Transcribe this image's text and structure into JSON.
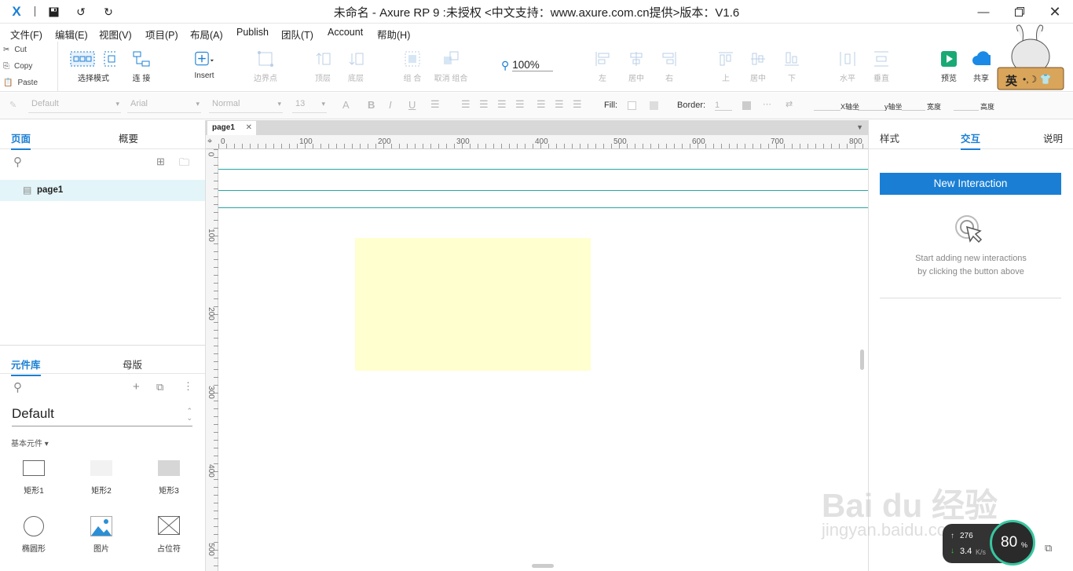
{
  "window": {
    "title": "未命名 - Axure RP 9  :未授权     <中文支持：www.axure.com.cn提供>版本：V1.6"
  },
  "menu": [
    "文件(F)",
    "编辑(E)",
    "视图(V)",
    "项目(P)",
    "布局(A)",
    "Publish",
    "团队(T)",
    "Account",
    "帮助(H)"
  ],
  "clipboard": {
    "cut": "Cut",
    "copy": "Copy",
    "paste": "Paste"
  },
  "toolbar": {
    "select_mode": "选择模式",
    "connect": "连 接",
    "insert": "Insert",
    "boundary": "边界点",
    "top": "顶层",
    "bottom": "底层",
    "group": "组 合",
    "ungroup": "取消 组合",
    "zoom": "100%",
    "align_left": "左",
    "align_center": "居中",
    "align_right": "右",
    "align_top": "上",
    "align_middle": "居中",
    "align_bottom": "下",
    "dist_h": "水平",
    "dist_v": "垂直",
    "preview": "预览",
    "share": "共享"
  },
  "stylebar": {
    "style": "Default",
    "font": "Arial",
    "weight": "Normal",
    "size": "13",
    "fill": "Fill:",
    "border": "Border:",
    "border_value": "1",
    "x": "X轴坐",
    "y": "y轴坐",
    "w": "宽度",
    "h": "高度"
  },
  "pages": {
    "tab_pages": "页面",
    "tab_outline": "概要",
    "items": [
      "page1"
    ]
  },
  "library": {
    "tab_lib": "元件库",
    "tab_master": "母版",
    "selected": "Default",
    "section": "基本元件",
    "widgets": [
      "矩形1",
      "矩形2",
      "矩形3",
      "椭圆形",
      "图片",
      "占位符"
    ]
  },
  "canvas": {
    "tab": "page1",
    "ruler_h": [
      "0",
      "100",
      "200",
      "300",
      "400",
      "500",
      "600",
      "700",
      "800"
    ],
    "ruler_v": [
      "0",
      "100",
      "200",
      "300",
      "400",
      "500"
    ]
  },
  "right": {
    "tab_style": "样式",
    "tab_interact": "交互",
    "tab_notes": "说明",
    "new_interaction": "New Interaction",
    "hint1": "Start adding new interactions",
    "hint2": "by clicking the button above"
  },
  "overlay": {
    "ime": "英",
    "speed1": "276",
    "speed2": "3.4",
    "speed_unit": "K/s",
    "percent": "80",
    "watermark1": "Bai du 经验",
    "watermark2": "jingyan.baidu.com"
  },
  "colors": {
    "accent": "#1a7fd4",
    "guide": "#27a7a4",
    "shape_fill": "#ffffd0"
  }
}
